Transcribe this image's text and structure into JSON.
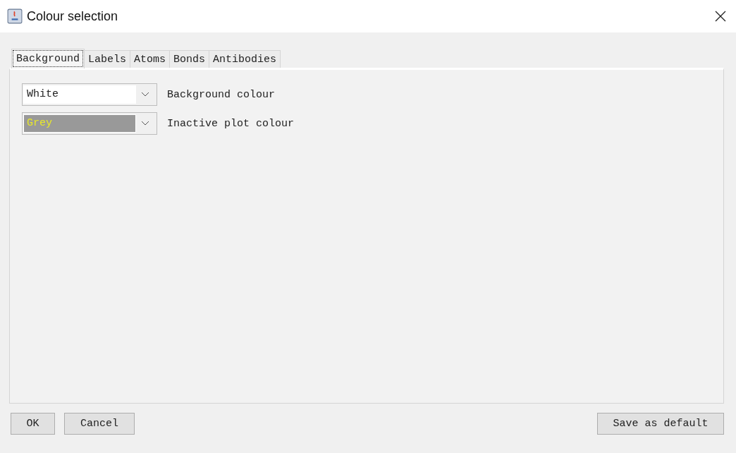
{
  "window": {
    "title": "Colour selection"
  },
  "tabs": [
    {
      "label": "Background",
      "selected": true
    },
    {
      "label": "Labels",
      "selected": false
    },
    {
      "label": "Atoms",
      "selected": false
    },
    {
      "label": "Bonds",
      "selected": false
    },
    {
      "label": "Antibodies",
      "selected": false
    }
  ],
  "settings": [
    {
      "value": "White",
      "color": "#ffffff",
      "focused": false,
      "label": "Background colour"
    },
    {
      "value": "Grey",
      "color": "#999999",
      "focused": true,
      "label": "Inactive plot colour"
    }
  ],
  "buttons_left": [
    "OK",
    "Cancel"
  ],
  "buttons_right": [
    "Save as default"
  ]
}
